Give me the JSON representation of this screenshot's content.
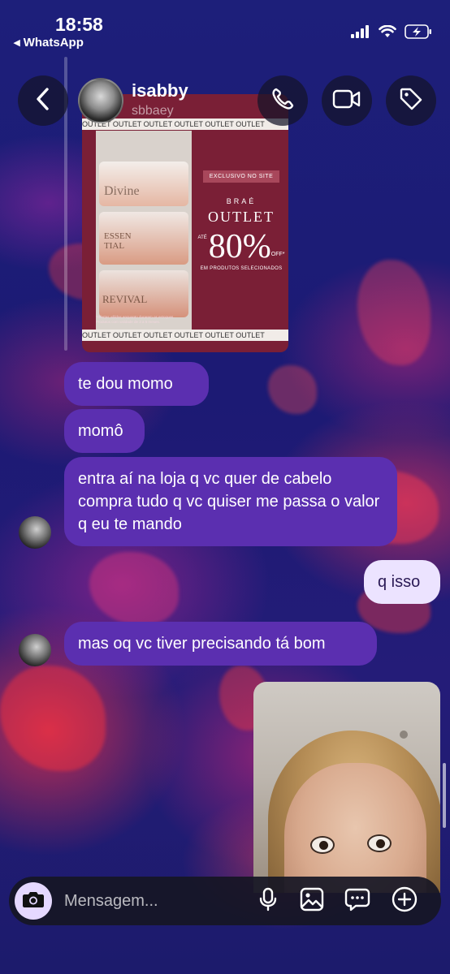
{
  "status_bar": {
    "time": "18:58",
    "back_label": "◂ WhatsApp",
    "signal_icon": "cellular-signal-icon",
    "wifi_icon": "wifi-icon",
    "battery_icon": "battery-charging-icon"
  },
  "header": {
    "contact_name": "isabby",
    "contact_username": "sbbaey"
  },
  "shared_ad": {
    "strip_text": "OUTLET  OUTLET  OUTLET  OUTLET  OUTLET  OUTLET",
    "badge": "EXCLUSIVO NO SITE",
    "brand": "BRAÉ",
    "title": "OUTLET",
    "prefix": "ATÉ",
    "discount": "80%",
    "off": "OFF*",
    "subtitle": "EM PRODUTOS SELECIONADOS",
    "jar1": "Divine",
    "jar2": "ESSEN TIAL",
    "jar3": "REVIVAL",
    "footnote": "*Ofertas válidas enquanto durarem os estoques. Produtos com validade de 3 a 6 meses."
  },
  "messages": [
    {
      "text": "te dou momo"
    },
    {
      "text": "momô"
    },
    {
      "text": "entra aí na loja q vc quer de cabelo compra tudo q vc quiser me passa o valor q eu te mando"
    },
    {
      "text": "q isso"
    },
    {
      "text": "mas oq vc tiver precisando tá bom"
    }
  ],
  "composer": {
    "placeholder": "Mensagem..."
  },
  "colors": {
    "received_bubble": "#5b2fb0",
    "sent_bubble": "#ece3ff",
    "camera_button": "#e5d8ff"
  }
}
